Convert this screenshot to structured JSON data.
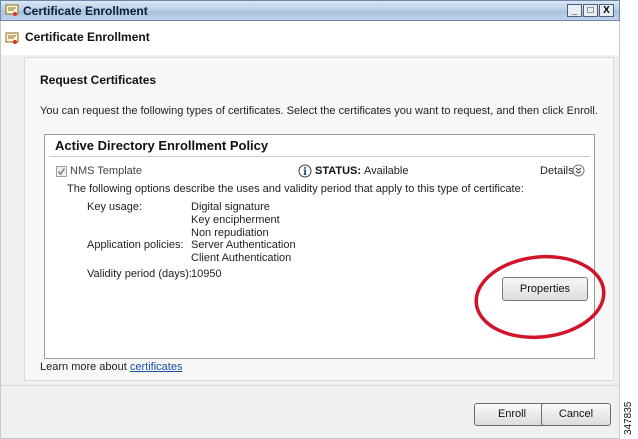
{
  "window": {
    "title": "Certificate Enrollment",
    "controls": {
      "minimize": "_",
      "maximize": "□",
      "close": "X"
    }
  },
  "header": {
    "title": "Certificate Enrollment"
  },
  "main": {
    "section_title": "Request Certificates",
    "instructions": "You can request the following types of certificates. Select the certificates you want to request, and then click Enroll.",
    "policy": {
      "title": "Active Directory Enrollment Policy",
      "certificate": {
        "name": "NMS Template",
        "checked": true,
        "status_label": "STATUS:",
        "status_value": "Available",
        "details_label": "Details",
        "description": "The following options describe the uses and validity period that apply to this type of certificate:",
        "key_usage_label": "Key usage:",
        "key_usage": [
          "Digital signature",
          "Key encipherment",
          "Non repudiation"
        ],
        "app_policies_label": "Application policies:",
        "app_policies": [
          "Server Authentication",
          "Client Authentication"
        ],
        "validity_label": "Validity period (days):",
        "validity_value": "10950",
        "properties_button": "Properties"
      }
    },
    "learn_more": {
      "text": "Learn more about ",
      "link": "certificates"
    }
  },
  "footer": {
    "enroll_button": "Enroll",
    "cancel_button": "Cancel"
  },
  "side_code": "347835",
  "colors": {
    "annotation_circle": "#d2142a",
    "link": "#1b4ea6",
    "titlebar": "#b9cde6"
  },
  "icons": {
    "window": "certificate-icon",
    "header": "certificate-icon",
    "status": "info-icon",
    "details": "expand-chevron-icon"
  }
}
